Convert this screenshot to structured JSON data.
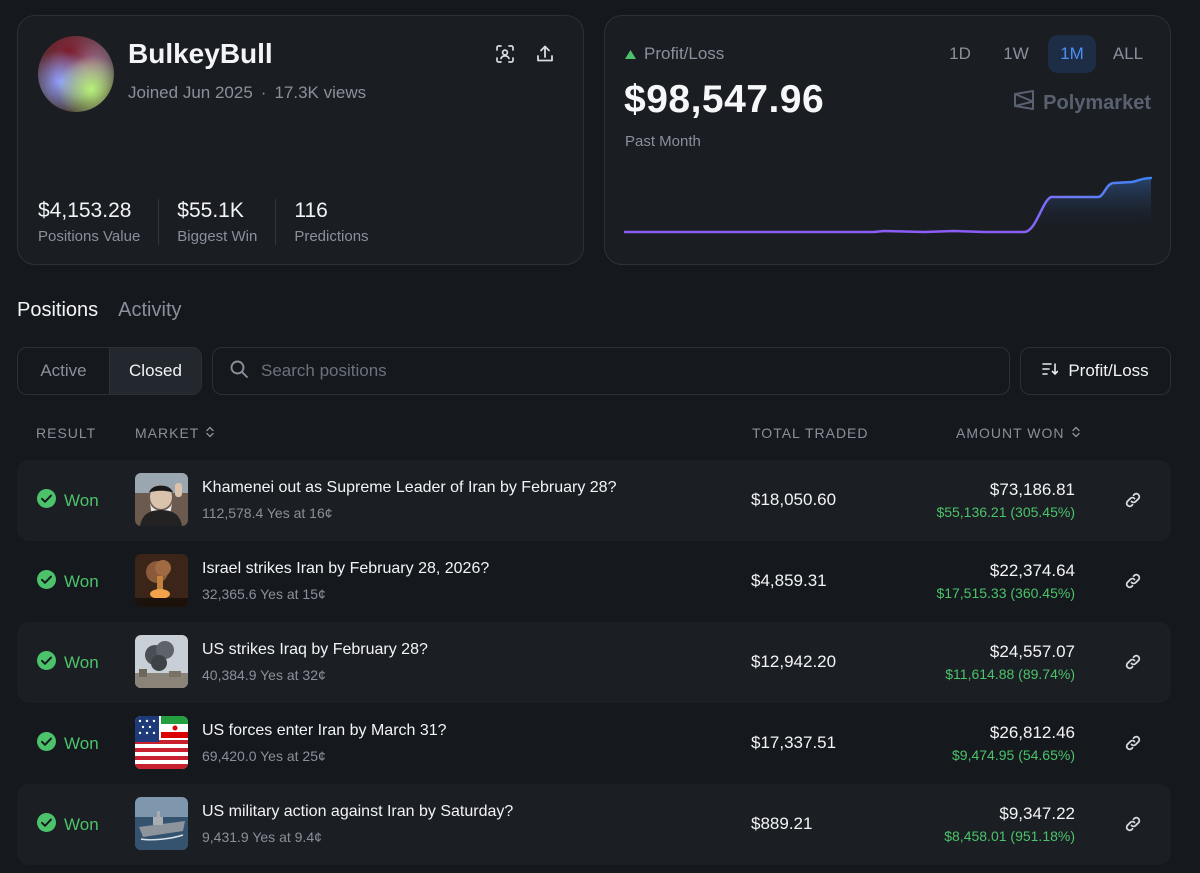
{
  "profile": {
    "username": "BulkeyBull",
    "joined": "Joined Jun 2025",
    "dot": "·",
    "views": "17.3K views",
    "stats": [
      {
        "value": "$4,153.28",
        "label": "Positions Value"
      },
      {
        "value": "$55.1K",
        "label": "Biggest Win"
      },
      {
        "value": "116",
        "label": "Predictions"
      }
    ]
  },
  "pnl": {
    "label": "Profit/Loss",
    "value": "$98,547.96",
    "period": "Past Month",
    "brand": "Polymarket",
    "ranges": [
      "1D",
      "1W",
      "1M",
      "ALL"
    ],
    "active_range": "1M",
    "colors": {
      "accent": "#4d8ff7",
      "line_start": "#8b5cf6",
      "line_end": "#3b82f6",
      "up": "#4cc36b"
    }
  },
  "tabs": [
    "Positions",
    "Activity"
  ],
  "filters": {
    "segments": [
      "Active",
      "Closed"
    ],
    "active_segment": "Closed",
    "search_placeholder": "Search positions",
    "sort_label": "Profit/Loss"
  },
  "table": {
    "headers": {
      "result": "RESULT",
      "market": "MARKET",
      "total_traded": "TOTAL TRADED",
      "amount_won": "AMOUNT WON"
    },
    "rows": [
      {
        "result": "Won",
        "title": "Khamenei out as Supreme Leader of Iran by February 28?",
        "sub": "112,578.4 Yes at 16¢",
        "traded": "$18,050.60",
        "won": "$73,186.81",
        "profit": "$55,136.21 (305.45%)",
        "thumb": "portrait"
      },
      {
        "result": "Won",
        "title": "Israel strikes Iran by February 28, 2026?",
        "sub": "32,365.6 Yes at 15¢",
        "traded": "$4,859.31",
        "won": "$22,374.64",
        "profit": "$17,515.33 (360.45%)",
        "thumb": "explosion"
      },
      {
        "result": "Won",
        "title": "US strikes Iraq by February 28?",
        "sub": "40,384.9 Yes at 32¢",
        "traded": "$12,942.20",
        "won": "$24,557.07",
        "profit": "$11,614.88 (89.74%)",
        "thumb": "smoke"
      },
      {
        "result": "Won",
        "title": "US forces enter Iran by March 31?",
        "sub": "69,420.0 Yes at 25¢",
        "traded": "$17,337.51",
        "won": "$26,812.46",
        "profit": "$9,474.95 (54.65%)",
        "thumb": "flags"
      },
      {
        "result": "Won",
        "title": "US military action against Iran by Saturday?",
        "sub": "9,431.9 Yes at 9.4¢",
        "traded": "$889.21",
        "won": "$9,347.22",
        "profit": "$8,458.01 (951.18%)",
        "thumb": "ship"
      }
    ]
  }
}
